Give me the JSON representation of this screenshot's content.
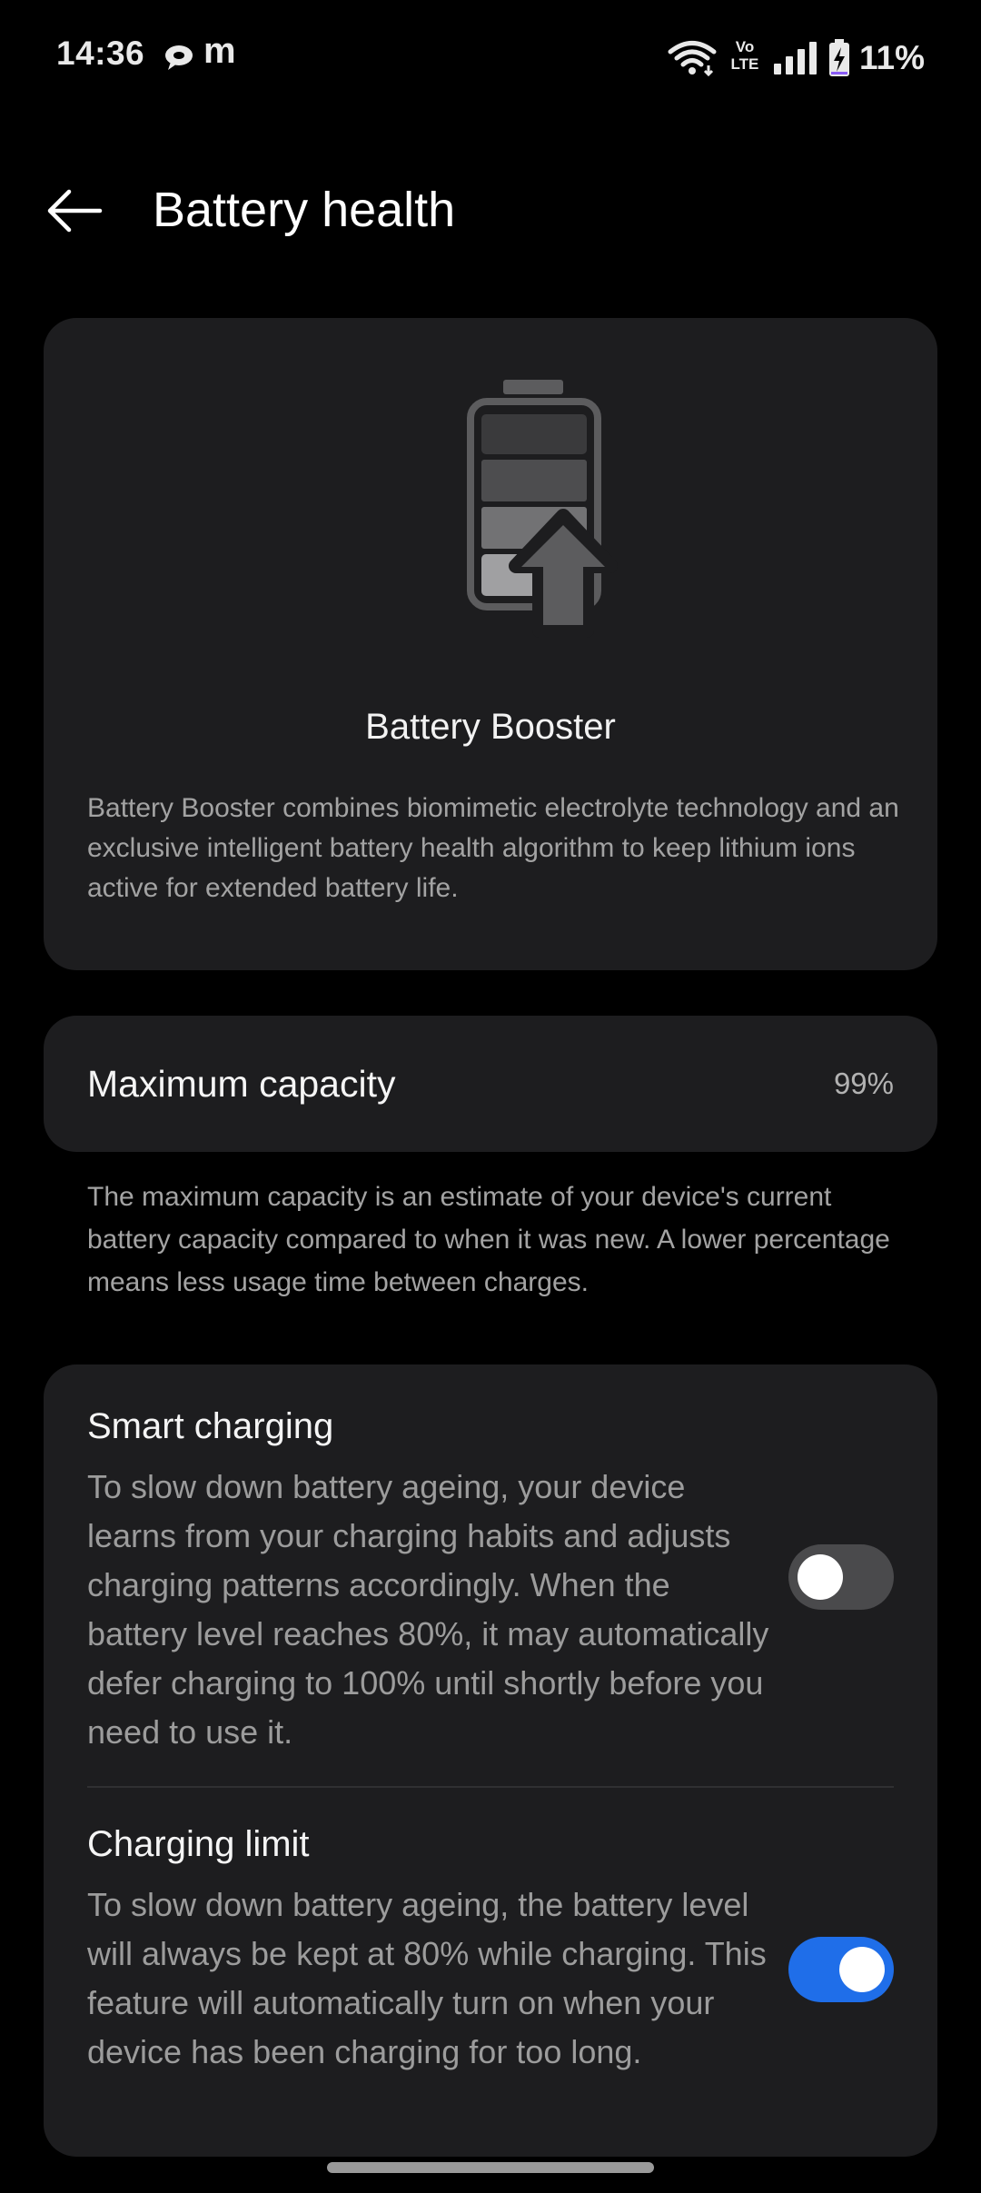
{
  "status_bar": {
    "time": "14:36",
    "notification_icons": [
      "chat-bubble-icon",
      "m-app-icon"
    ],
    "m_glyph": "m",
    "network_badge_line1": "Vo",
    "network_badge_line2": "LTE",
    "battery_percent": "11%",
    "battery_level": 0.11,
    "charging": true
  },
  "header": {
    "back_icon": "arrow-left-icon",
    "title": "Battery health"
  },
  "booster": {
    "illustration": "battery-booster-icon",
    "title": "Battery Booster",
    "description": "Battery Booster combines biomimetic electrolyte technology and an exclusive intelligent battery health algorithm to keep lithium ions active for extended battery life."
  },
  "capacity": {
    "label": "Maximum capacity",
    "value": "99%",
    "note": "The maximum capacity is an estimate of your device's current battery capacity compared to when it was new. A lower percentage means less usage time between charges."
  },
  "settings": [
    {
      "title": "Smart charging",
      "description": "To slow down battery ageing, your device learns from your charging habits and adjusts charging patterns accordingly. When the battery level reaches 80%, it may automatically defer charging to 100% until shortly before you need to use it.",
      "enabled": false
    },
    {
      "title": "Charging limit",
      "description": "To slow down battery ageing, the battery level will always be kept at 80% while charging. This feature will automatically turn on when your device has been charging for too long.",
      "enabled": true
    }
  ],
  "colors": {
    "background": "#000000",
    "card": "#1d1d1f",
    "toggle_on": "#1f6ee9",
    "toggle_off": "#4a4a4c",
    "battery_charging_accent": "#8a5cf6"
  }
}
